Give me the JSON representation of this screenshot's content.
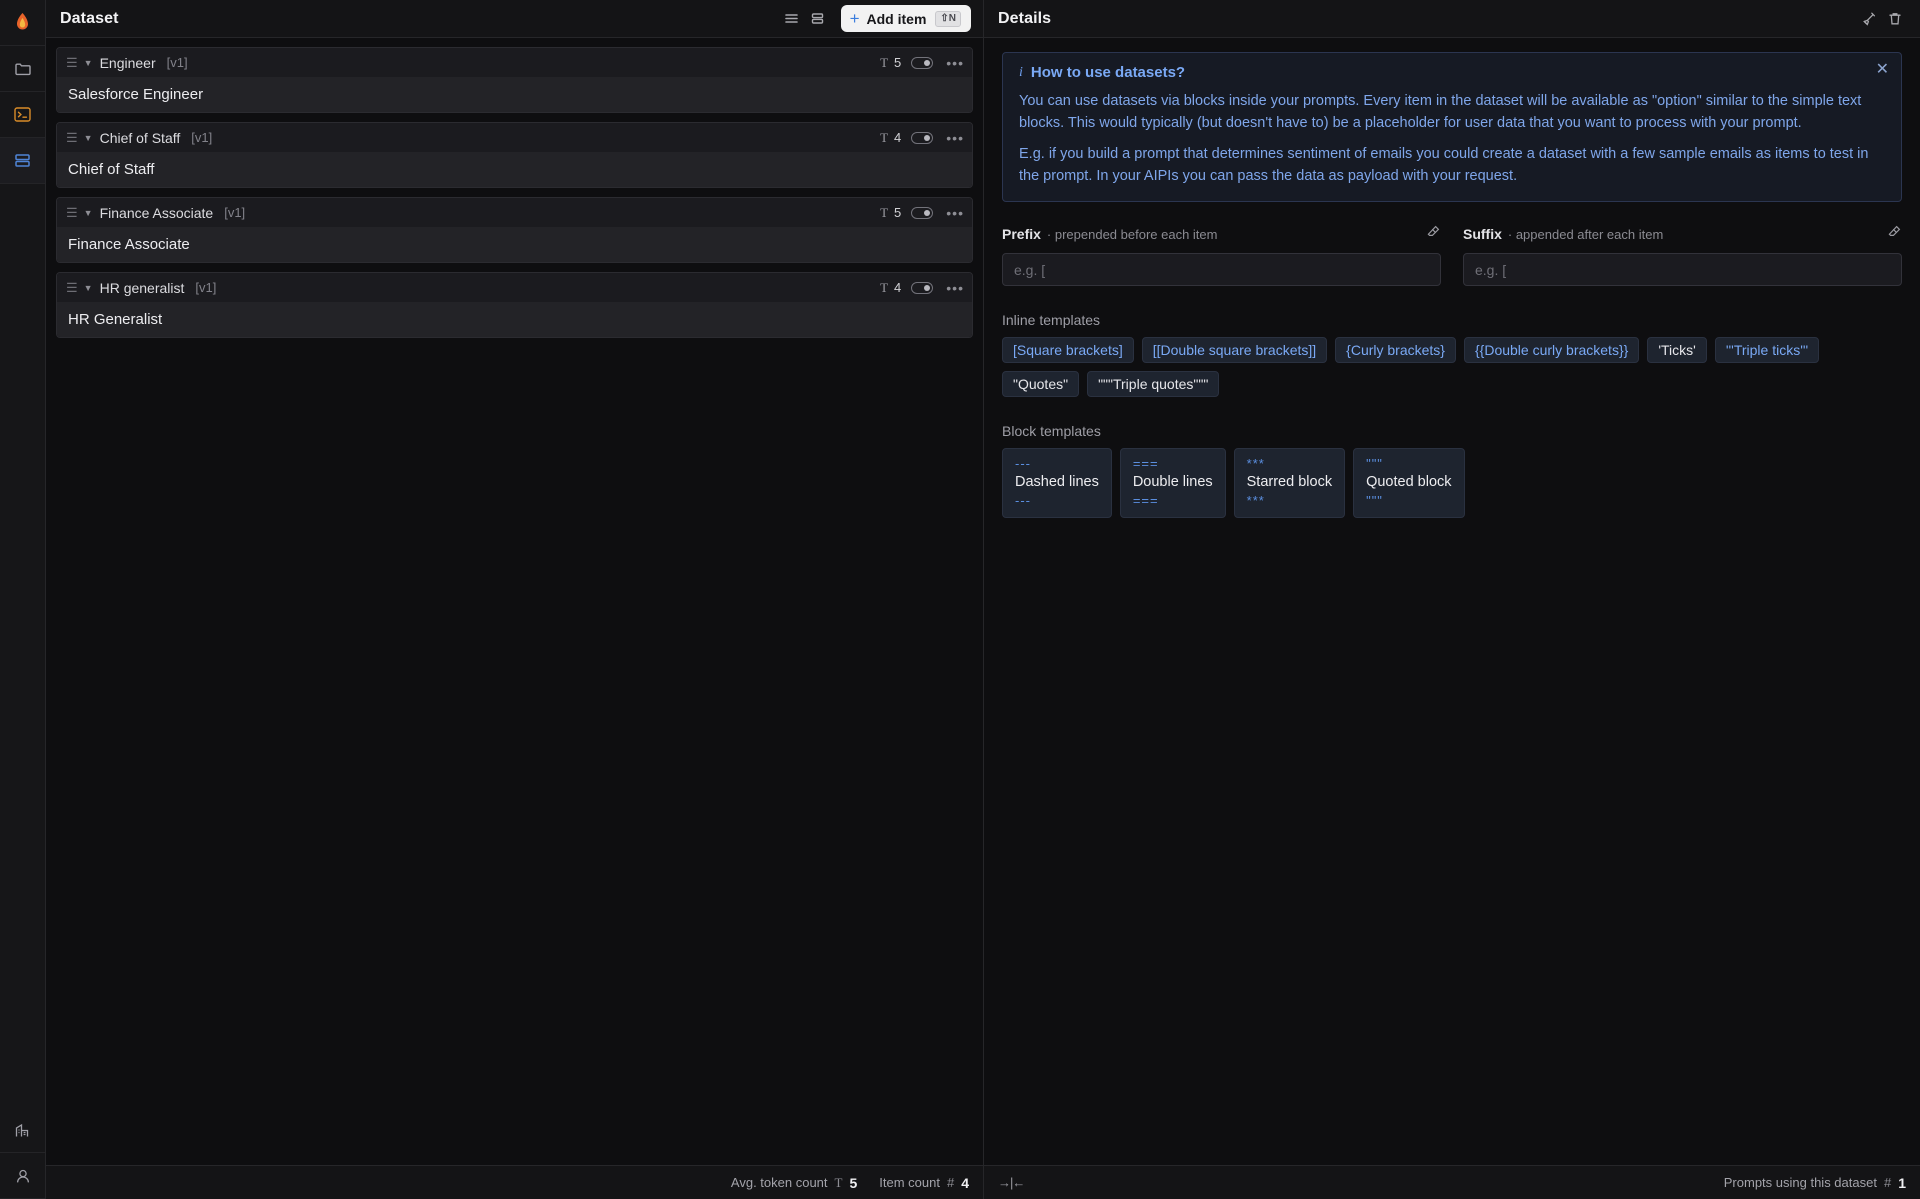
{
  "rail": {
    "logo": {
      "icon": "flame-icon",
      "name": "app-logo"
    },
    "items": [
      {
        "icon": "folder-icon",
        "name": "rail-item-files",
        "active": false
      },
      {
        "icon": "terminal-icon",
        "name": "rail-item-terminal",
        "active": false
      },
      {
        "icon": "database-icon",
        "name": "rail-item-datasets",
        "active": true
      }
    ],
    "bottom": [
      {
        "icon": "building-icon",
        "name": "rail-item-organization"
      },
      {
        "icon": "user-icon",
        "name": "rail-item-account"
      }
    ]
  },
  "dataset_panel": {
    "title": "Dataset",
    "toolbar": {
      "list_view_icon": "list-view-icon",
      "split_view_icon": "split-view-icon",
      "add_label": "Add item",
      "add_plus": "+",
      "add_shortcut": "⇧N"
    },
    "items": [
      {
        "name": "Engineer",
        "version": "[v1]",
        "token_count": "5",
        "value": "Salesforce Engineer"
      },
      {
        "name": "Chief of Staff",
        "version": "[v1]",
        "token_count": "4",
        "value": "Chief of Staff"
      },
      {
        "name": "Finance Associate",
        "version": "[v1]",
        "token_count": "5",
        "value": "Finance Associate"
      },
      {
        "name": "HR generalist",
        "version": "[v1]",
        "token_count": "4",
        "value": "HR Generalist"
      }
    ],
    "status": {
      "avg_token_label": "Avg. token count",
      "avg_token_symbol": "T",
      "avg_token_value": "5",
      "item_count_label": "Item count",
      "item_count_symbol": "#",
      "item_count_value": "4",
      "collapse_icon": "collapse-horizontal-icon"
    }
  },
  "details_panel": {
    "title": "Details",
    "toolbar": {
      "clear_icon": "broom-icon",
      "delete_icon": "trash-icon"
    },
    "info": {
      "icon": "info-icon",
      "title": "How to use datasets?",
      "close_icon": "close-icon",
      "paragraph1": "You can use datasets via blocks inside your prompts. Every item in the dataset will be available as \"option\" similar to the simple text blocks. This would typically (but doesn't have to) be a placeholder for user data that you want to process with your prompt.",
      "paragraph2": "E.g. if you build a prompt that determines sentiment of emails you could create a dataset with a few sample emails as items to test in the prompt. In your AIPIs you can pass the data as payload with your request."
    },
    "prefix": {
      "label": "Prefix",
      "hint": "· prepended before each item",
      "placeholder": "e.g. [",
      "value": "",
      "erase_icon": "eraser-icon"
    },
    "suffix": {
      "label": "Suffix",
      "hint": "· appended after each item",
      "placeholder": "e.g. [",
      "value": "",
      "erase_icon": "eraser-icon"
    },
    "inline_templates": {
      "label": "Inline templates",
      "chips": [
        {
          "label": "[Square brackets]",
          "style": "accent"
        },
        {
          "label": "[[Double square brackets]]",
          "style": "accent"
        },
        {
          "label": "{Curly brackets}",
          "style": "accent"
        },
        {
          "label": "{{Double curly brackets}}",
          "style": "accent"
        },
        {
          "label": "'Ticks'",
          "style": "plain"
        },
        {
          "label": "'''Triple ticks'''",
          "style": "accent"
        },
        {
          "label": "\"Quotes\"",
          "style": "plain"
        },
        {
          "label": "\"\"\"Triple quotes\"\"\"",
          "style": "plain"
        }
      ]
    },
    "block_templates": {
      "label": "Block templates",
      "blocks": [
        {
          "mark_top": "---",
          "label": "Dashed lines",
          "mark_bottom": "---"
        },
        {
          "mark_top": "===",
          "label": "Double lines",
          "mark_bottom": "==="
        },
        {
          "mark_top": "***",
          "label": "Starred block",
          "mark_bottom": "***"
        },
        {
          "mark_top": "\"\"\"",
          "label": "Quoted block",
          "mark_bottom": "\"\"\""
        }
      ]
    },
    "status": {
      "collapse_icon": "collapse-horizontal-icon",
      "prompts_label": "Prompts using this dataset",
      "prompts_symbol": "#",
      "prompts_value": "1"
    }
  }
}
